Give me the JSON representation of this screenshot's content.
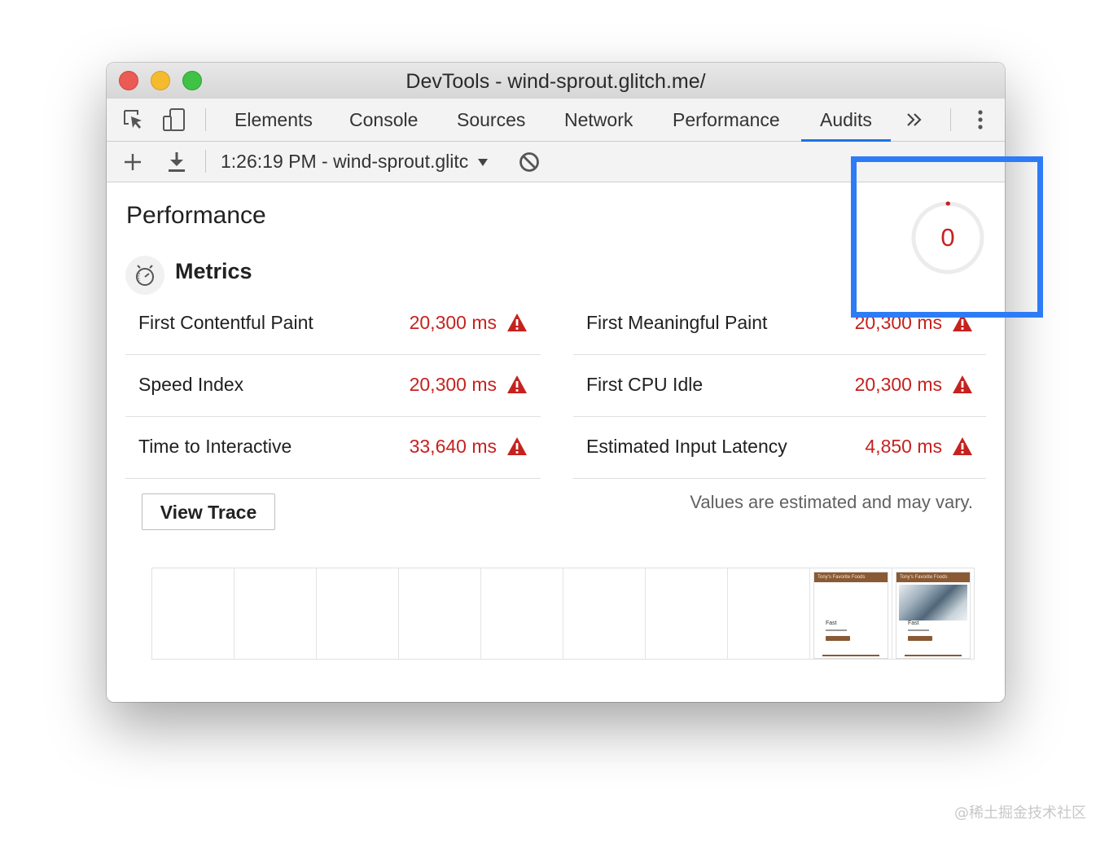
{
  "window": {
    "title": "DevTools - wind-sprout.glitch.me/"
  },
  "tabs": [
    {
      "label": "Elements",
      "active": false
    },
    {
      "label": "Console",
      "active": false
    },
    {
      "label": "Sources",
      "active": false
    },
    {
      "label": "Network",
      "active": false
    },
    {
      "label": "Performance",
      "active": false
    },
    {
      "label": "Audits",
      "active": true
    }
  ],
  "toolbar": {
    "report_select": "1:26:19 PM - wind-sprout.glitc"
  },
  "performance": {
    "heading": "Performance",
    "score": "0",
    "score_fraction": 0.0,
    "metrics_label": "Metrics",
    "metrics": [
      {
        "name": "First Contentful Paint",
        "value": "20,300 ms"
      },
      {
        "name": "First Meaningful Paint",
        "value": "20,300 ms"
      },
      {
        "name": "Speed Index",
        "value": "20,300 ms"
      },
      {
        "name": "First CPU Idle",
        "value": "20,300 ms"
      },
      {
        "name": "Time to Interactive",
        "value": "33,640 ms"
      },
      {
        "name": "Estimated Input Latency",
        "value": "4,850 ms"
      }
    ],
    "view_trace": "View Trace",
    "estimate_note": "Values are estimated and may vary."
  },
  "filmstrip": {
    "thumb_title": "Tony's Favorite Foods",
    "thumb_caption": "Fast"
  },
  "colors": {
    "fail": "#c5221f",
    "accent": "#1a73e8",
    "highlight": "#2d7cf6"
  },
  "icons": [
    "inspect-icon",
    "device-toggle-icon",
    "more-tabs-icon",
    "kebab-menu-icon",
    "add-icon",
    "download-icon",
    "dropdown-arrow-icon",
    "clear-icon",
    "stopwatch-icon",
    "warning-icon"
  ],
  "watermark": "@稀土掘金技术社区"
}
